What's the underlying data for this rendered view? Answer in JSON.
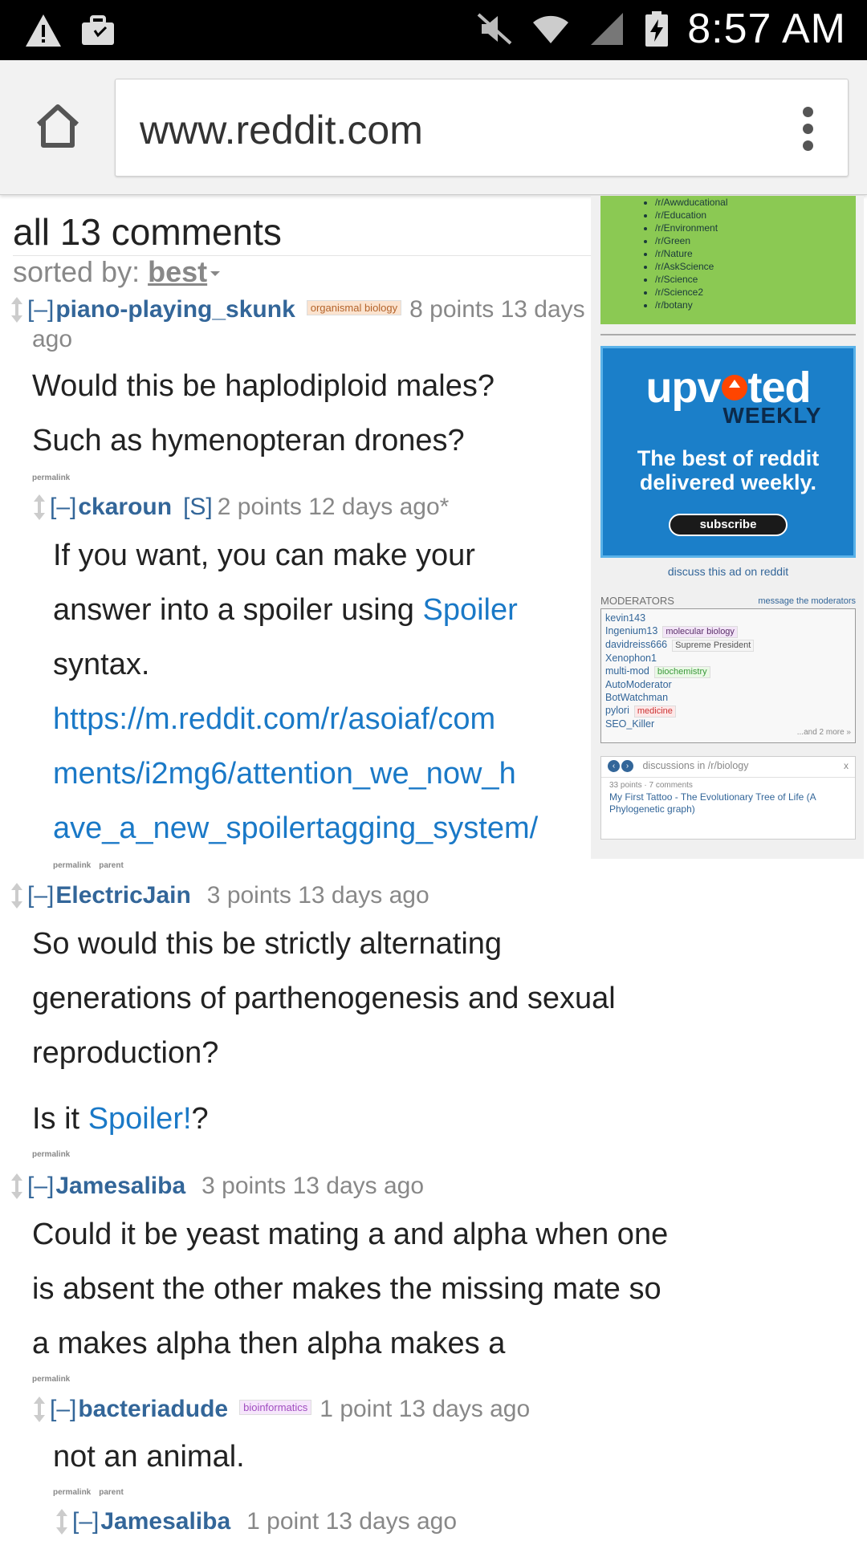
{
  "status_bar": {
    "time": "8:57 AM",
    "icons": [
      "warning-icon",
      "briefcase-icon",
      "mute-icon",
      "wifi-icon",
      "signal-icon",
      "battery-charging-icon"
    ]
  },
  "browser": {
    "url": "www.reddit.com",
    "icons": [
      "home-icon",
      "overflow-menu-icon"
    ]
  },
  "main": {
    "title": "all 13 comments",
    "sorted_label": "sorted by:",
    "sorted_value": "best"
  },
  "comments": [
    {
      "toggle": "[–]",
      "author": "piano-playing_skunk",
      "flair": "organismal biology",
      "points": "8 points",
      "age": "13 days",
      "age_wrap": "ago",
      "body_lines": [
        "Would this be haplodiploid males?",
        "Such as hymenopteran drones?"
      ],
      "links": [
        "permalink"
      ]
    },
    {
      "toggle": "[–]",
      "author": "ckaroun",
      "submitter": "[S]",
      "points": "2 points",
      "age": "12 days ago*",
      "body_line1": "If you want, you can make your",
      "body_line2_pre": "answer into a spoiler using ",
      "body_line2_link": "Spoiler",
      "body_line3": "syntax.",
      "body_url_lines": [
        "https://m.reddit.com/r/asoiaf/com",
        "ments/i2mg6/attention_we_now_h",
        "ave_a_new_spoilertagging_system/"
      ],
      "links": [
        "permalink",
        "parent"
      ]
    },
    {
      "toggle": "[–]",
      "author": "ElectricJain",
      "points": "3 points",
      "age": "13 days ago",
      "body_lines": [
        "So would this be strictly alternating",
        "generations of parthenogenesis and sexual",
        "reproduction?"
      ],
      "body_q_pre": "Is it ",
      "body_q_link": "Spoiler!",
      "body_q_post": "?",
      "links": [
        "permalink"
      ]
    },
    {
      "toggle": "[–]",
      "author": "Jamesaliba",
      "points": "3 points",
      "age": "13 days ago",
      "body_lines": [
        "Could it be yeast mating a and alpha when one",
        "is absent the other makes the missing mate so",
        "a makes alpha then alpha makes a"
      ],
      "links": [
        "permalink"
      ]
    },
    {
      "toggle": "[–]",
      "author": "bacteriadude",
      "flair": "bioinformatics",
      "points": "1 point",
      "age": "13 days ago",
      "body_lines": [
        "not an animal."
      ],
      "links": [
        "permalink",
        "parent"
      ]
    },
    {
      "toggle": "[–]",
      "author": "Jamesaliba",
      "points": "1 point",
      "age": "13 days ago"
    }
  ],
  "sidebar": {
    "subreddits": [
      "/r/Awwducational",
      "/r/Education",
      "/r/Environment",
      "/r/Green",
      "/r/Nature",
      "/r/AskScience",
      "/r/Science",
      "/r/Science2",
      "/r/botany"
    ],
    "ad": {
      "brand_part1": "upv",
      "brand_part2": "ted",
      "brand_sub": "WEEKLY",
      "tagline_1": "The best of reddit",
      "tagline_2": "delivered weekly.",
      "button": "subscribe"
    },
    "discuss_ad": "discuss this ad on reddit",
    "moderators_title": "MODERATORS",
    "message_mods": "message the moderators",
    "moderators": [
      {
        "name": "kevin143",
        "flair": ""
      },
      {
        "name": "Ingenium13",
        "flair": "molecular biology"
      },
      {
        "name": "davidreiss666",
        "flair": "Supreme President"
      },
      {
        "name": "Xenophon1",
        "flair": ""
      },
      {
        "name": "multi-mod",
        "flair": "biochemistry"
      },
      {
        "name": "AutoModerator",
        "flair": ""
      },
      {
        "name": "BotWatchman",
        "flair": ""
      },
      {
        "name": "pylori",
        "flair": "medicine"
      },
      {
        "name": "SEO_Killer",
        "flair": ""
      }
    ],
    "mods_more": "...and 2 more »",
    "discussions_title": "discussions in /r/biology",
    "discussions_close": "x",
    "discussion_meta": "33 points · 7 comments",
    "discussion_title": "My First Tattoo - The Evolutionary Tree of Life (A Phylogenetic graph)"
  },
  "colors": {
    "link": "#336699",
    "sidebar_green": "#8bc953",
    "ad_blue": "#1b7fc9",
    "spoiler_link": "#1a79c7"
  }
}
